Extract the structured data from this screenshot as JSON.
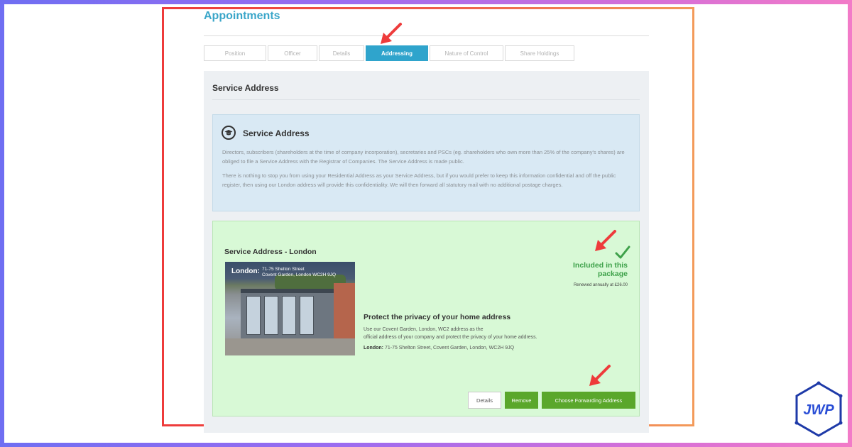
{
  "page_title": "Appointments",
  "tabs": [
    {
      "label": "Position",
      "active": false
    },
    {
      "label": "Officer",
      "active": false
    },
    {
      "label": "Details",
      "active": false
    },
    {
      "label": "Addressing",
      "active": true
    },
    {
      "label": "Nature of Control",
      "active": false
    },
    {
      "label": "Share Holdings",
      "active": false
    }
  ],
  "section": {
    "title": "Service Address"
  },
  "info_box": {
    "icon": "graduation-cap-icon",
    "title": "Service Address",
    "para1": "Directors, subscribers (shareholders at the time of company incorporation), secretaries and PSCs (eg. shareholders who own more than 25% of the company's shares) are obliged to file a Service Address with the Registrar of Companies. The Service Address is made public.",
    "para2": "There is nothing to stop you from using your Residential Address as your Service Address, but if you would prefer to keep this information confidential and off the public register, then using our London address will provide this confidentiality. We will then forward all statutory mail with no additional postage charges."
  },
  "offer": {
    "title": "Service Address - London",
    "photo_city": "London:",
    "photo_addr_line1": "71-75 Shelton Street",
    "photo_addr_line2": "Covent Garden, London WC2H 9JQ",
    "included_text": "Included in this package",
    "renewal": "Renewed annually at £26.00",
    "protect_title": "Protect the privacy of your home address",
    "protect_line1": "Use our Covent Garden, London, WC2 address as the",
    "protect_line2": "official address of your company and protect the privacy of your home address.",
    "address_label": "London:",
    "address_value": "71-75 Shelton Street, Covent Garden, London, WC2H 9JQ"
  },
  "buttons": {
    "details": "Details",
    "remove": "Remove",
    "choose": "Choose Forwarding Address"
  },
  "colors": {
    "accent": "#2fa4cc",
    "success_green": "#5aa72b",
    "included_green": "#3ea14a",
    "annotation_red": "#ee3b3b"
  },
  "logo_text": "JWP"
}
